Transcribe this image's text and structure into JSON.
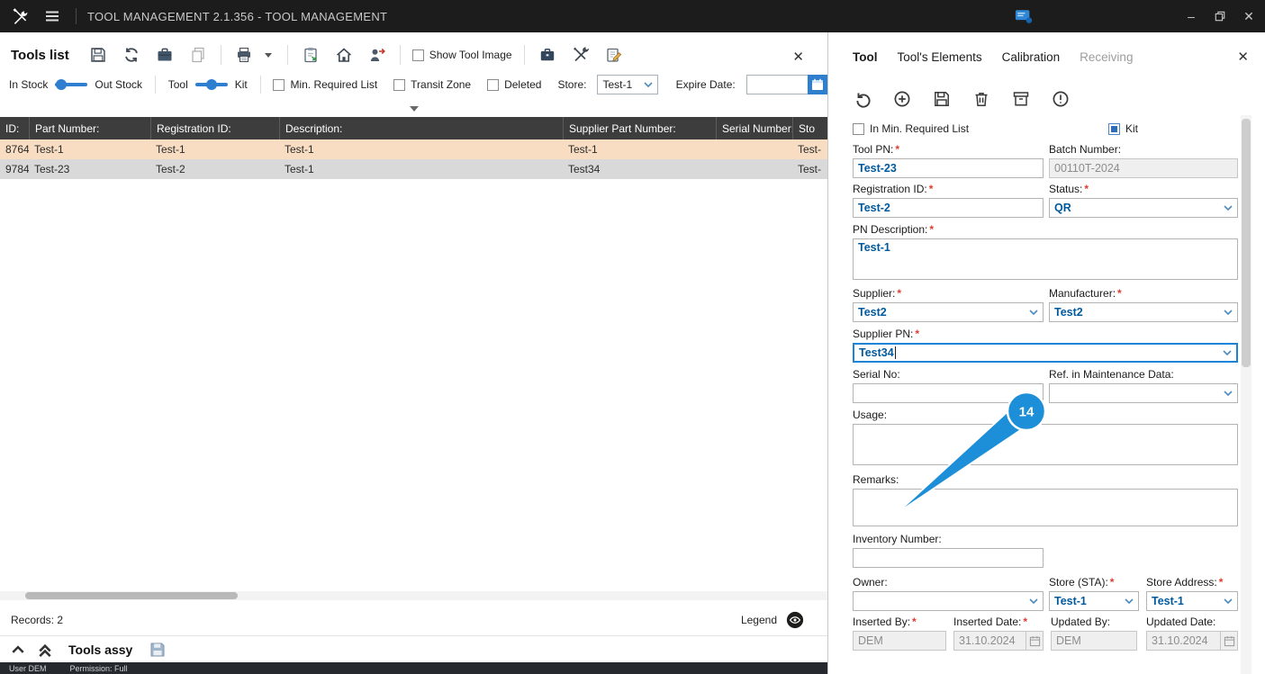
{
  "titlebar": {
    "title": "TOOL MANAGEMENT 2.1.356 - TOOL MANAGEMENT"
  },
  "icons": {
    "close": "✕",
    "minimize": "–"
  },
  "left_panel": {
    "title": "Tools list",
    "toolbar": {
      "show_tool_image": "Show Tool Image"
    },
    "filters": {
      "in_stock": "In Stock",
      "out_stock": "Out Stock",
      "tool": "Tool",
      "kit": "Kit",
      "min_required_list": "Min. Required List",
      "transit_zone": "Transit Zone",
      "deleted": "Deleted",
      "store_label": "Store:",
      "store_value": "Test-1",
      "expire_date_label": "Expire Date:",
      "expire_date_value": ""
    },
    "table": {
      "columns": {
        "id": "ID:",
        "part_number": "Part Number:",
        "registration_id": "Registration ID:",
        "description": "Description:",
        "supplier_part_number": "Supplier Part Number:",
        "serial_number": "Serial Number:",
        "store": "Sto"
      },
      "rows": [
        {
          "id": "8764",
          "part_number": "Test-1",
          "registration_id": "Test-1",
          "description": "Test-1",
          "supplier_part_number": "Test-1",
          "serial_number": "",
          "store": "Test-"
        },
        {
          "id": "9784",
          "part_number": "Test-23",
          "registration_id": "Test-2",
          "description": "Test-1",
          "supplier_part_number": "Test34",
          "serial_number": "",
          "store": "Test-"
        }
      ]
    },
    "footer": {
      "records": "Records: 2",
      "legend": "Legend"
    },
    "assy_bar": {
      "title": "Tools assy"
    },
    "status": {
      "user": "User DEM",
      "permission": "Permission: Full"
    }
  },
  "detail_panel": {
    "tabs": {
      "tool": "Tool",
      "elements": "Tool's Elements",
      "calibration": "Calibration",
      "receiving": "Receiving"
    },
    "options": {
      "in_min_required_list": "In Min. Required List",
      "kit": "Kit"
    },
    "fields": {
      "tool_pn": {
        "label": "Tool PN:",
        "required": "*",
        "value": "Test-23"
      },
      "batch_number": {
        "label": "Batch Number:",
        "value": "00110T-2024"
      },
      "registration_id": {
        "label": "Registration ID:",
        "required": "*",
        "value": "Test-2"
      },
      "status": {
        "label": "Status:",
        "required": "*",
        "value": "QR"
      },
      "pn_description": {
        "label": "PN Description:",
        "required": "*",
        "value": "Test-1"
      },
      "supplier": {
        "label": "Supplier:",
        "required": "*",
        "value": "Test2"
      },
      "manufacturer": {
        "label": "Manufacturer:",
        "required": "*",
        "value": "Test2"
      },
      "supplier_pn": {
        "label": "Supplier PN:",
        "required": "*",
        "value": "Test34"
      },
      "serial_no": {
        "label": "Serial No:",
        "value": ""
      },
      "ref_maintenance": {
        "label": "Ref. in Maintenance Data:",
        "value": ""
      },
      "usage": {
        "label": "Usage:",
        "value": ""
      },
      "remarks": {
        "label": "Remarks:",
        "value": ""
      },
      "inventory_number": {
        "label": "Inventory Number:",
        "value": ""
      },
      "owner": {
        "label": "Owner:",
        "value": ""
      },
      "store_sta": {
        "label": "Store (STA):",
        "required": "*",
        "value": "Test-1"
      },
      "store_address": {
        "label": "Store Address:",
        "required": "*",
        "value": "Test-1"
      },
      "inserted_by": {
        "label": "Inserted By:",
        "required": "*",
        "value": "DEM"
      },
      "inserted_date": {
        "label": "Inserted Date:",
        "required": "*",
        "value": "31.10.2024"
      },
      "updated_by": {
        "label": "Updated By:",
        "value": "DEM"
      },
      "updated_date": {
        "label": "Updated Date:",
        "value": "31.10.2024"
      }
    },
    "callout": {
      "number": "14"
    }
  }
}
